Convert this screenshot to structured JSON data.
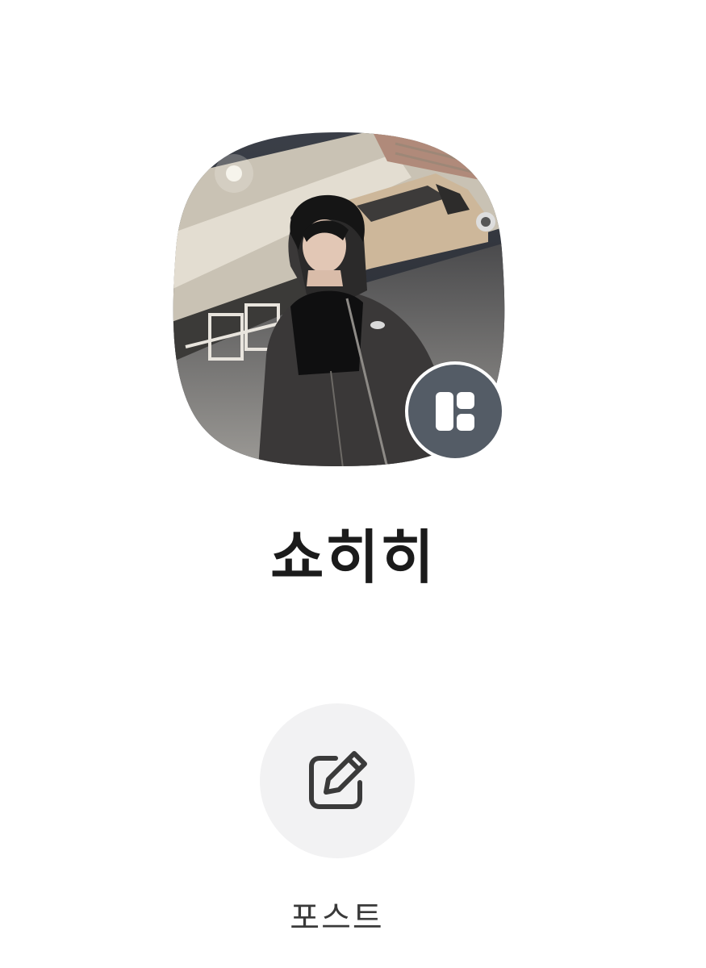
{
  "profile": {
    "name": "쇼히히",
    "badge_icon": "collage-icon"
  },
  "actions": {
    "post_label": "포스트",
    "post_icon": "edit-icon"
  },
  "colors": {
    "badge_bg": "#545c66",
    "post_button_bg": "#f2f2f3",
    "name_text": "#1b1b1b"
  }
}
